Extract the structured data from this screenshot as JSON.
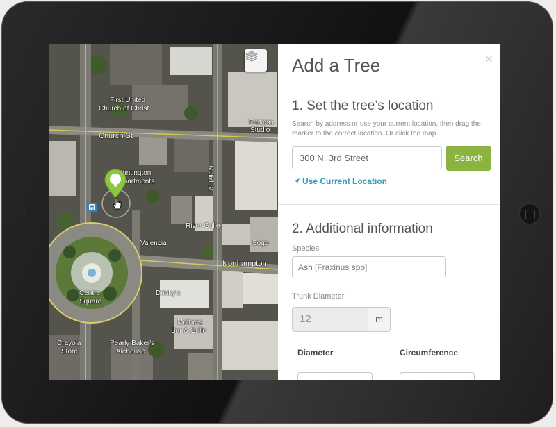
{
  "map": {
    "labels": [
      "First United",
      "Church of Christ",
      "Church St",
      "Fretless",
      "Studio",
      "Huntington",
      "Apartments",
      "River Grille",
      "Valencia",
      "Sogo",
      "Northampton",
      "Drinky's",
      "Centre",
      "Square",
      "Mothers",
      "Bar & Grille",
      "Crayola",
      "Store",
      "Pearly Baker's",
      "Alehouse",
      "N 3rd St"
    ]
  },
  "panel": {
    "title": "Add a Tree",
    "close_glyph": "×",
    "section1": {
      "heading": "1. Set the tree’s location",
      "help": "Search by address or use your current location, then drag the marker to the correct location. Or click the map.",
      "address_value": "300 N. 3rd Street",
      "search_label": "Search",
      "use_location_label": "Use Current Location"
    },
    "section2": {
      "heading": "2. Additional information",
      "species_label": "Species",
      "species_value": "Ash [Fraxinus spp]",
      "trunk_label": "Trunk Diameter",
      "trunk_value": "12",
      "trunk_unit": "m",
      "col_diameter": "Diameter",
      "col_circumference": "Circumference"
    }
  },
  "colors": {
    "accent_green": "#8bb33f",
    "link_teal": "#3a9bb5",
    "marker_green": "#8dc63f"
  },
  "icons": [
    "layers-icon",
    "tree-marker-icon",
    "bus-stop-icon",
    "location-arrow-icon",
    "close-icon"
  ]
}
